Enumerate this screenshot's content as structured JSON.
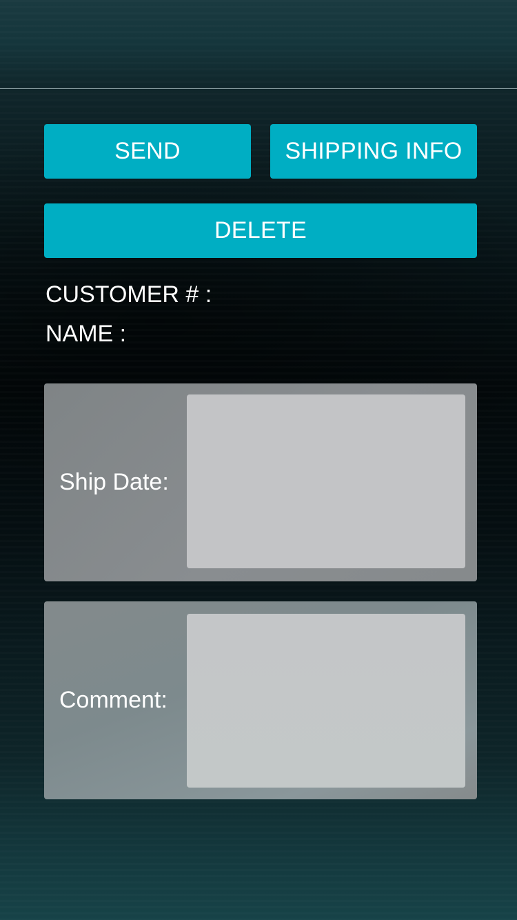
{
  "buttons": {
    "send_label": "SEND",
    "shipping_info_label": "SHIPPING INFO",
    "delete_label": "DELETE"
  },
  "customer": {
    "customer_number_label": "CUSTOMER # :",
    "name_label": "NAME :"
  },
  "form": {
    "ship_date_label": "Ship Date:",
    "ship_date_value": "",
    "comment_label": "Comment:",
    "comment_value": ""
  },
  "colors": {
    "accent": "#00aec3",
    "panel": "#868a8c",
    "field": "#c3c4c6"
  }
}
